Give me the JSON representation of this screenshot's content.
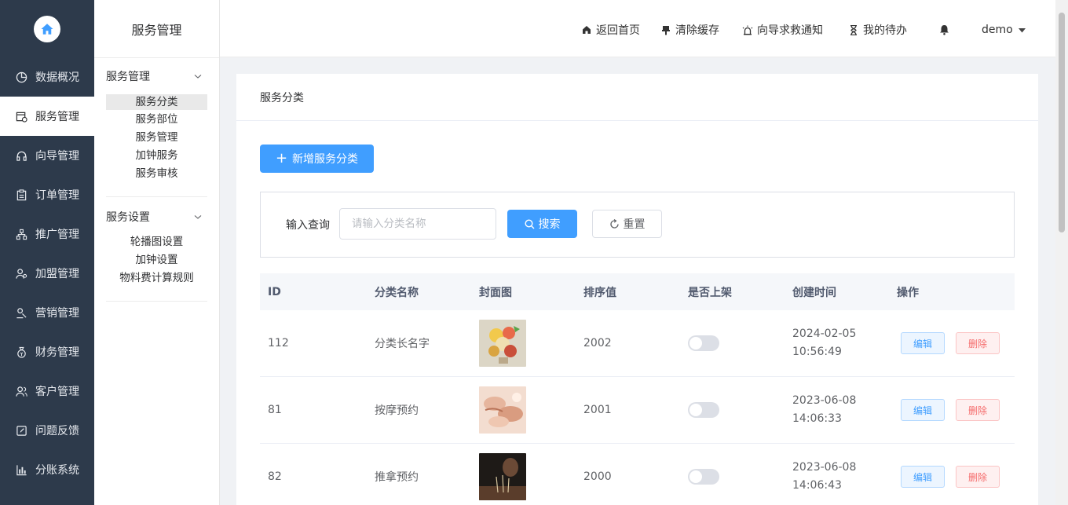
{
  "colors": {
    "sidebar_bg": "#2d3a4b",
    "primary": "#409eff",
    "danger": "#f56c6c"
  },
  "nav": {
    "logo_icon": "home-icon",
    "items": [
      {
        "label": "数据概况",
        "icon": "pie-chart-icon"
      },
      {
        "label": "服务管理",
        "icon": "service-calendar-icon",
        "active": true
      },
      {
        "label": "向导管理",
        "icon": "headset-icon"
      },
      {
        "label": "订单管理",
        "icon": "clipboard-icon"
      },
      {
        "label": "推广管理",
        "icon": "org-tree-icon"
      },
      {
        "label": "加盟管理",
        "icon": "user-group-icon"
      },
      {
        "label": "营销管理",
        "icon": "badge-icon"
      },
      {
        "label": "财务管理",
        "icon": "money-bag-icon"
      },
      {
        "label": "客户管理",
        "icon": "users-icon"
      },
      {
        "label": "问题反馈",
        "icon": "edit-square-icon"
      },
      {
        "label": "分账系统",
        "icon": "bar-chart-icon"
      }
    ]
  },
  "submenu": {
    "title": "服务管理",
    "groups": [
      {
        "label": "服务管理",
        "items": [
          "服务分类",
          "服务部位",
          "服务管理",
          "加钟服务",
          "服务审核"
        ],
        "active_index": 0
      },
      {
        "label": "服务设置",
        "items": [
          "轮播图设置",
          "加钟设置",
          "物料费计算规则"
        ]
      }
    ]
  },
  "header": {
    "home": "返回首页",
    "clear_cache": "清除缓存",
    "rescue": "向导求救通知",
    "todo": "我的待办",
    "user": "demo"
  },
  "page": {
    "breadcrumb": "服务分类",
    "add_button": "新增服务分类",
    "search_label": "输入查询",
    "search_placeholder": "请输入分类名称",
    "search_button": "搜索",
    "reset_button": "重置"
  },
  "table": {
    "headers": [
      "ID",
      "分类名称",
      "封面图",
      "排序值",
      "是否上架",
      "创建时间",
      "操作"
    ],
    "edit_label": "编辑",
    "delete_label": "删除",
    "rows": [
      {
        "id": "112",
        "name": "分类长名字",
        "cover": "fruit-photo",
        "sort": "2002",
        "listed": false,
        "date": "2024-02-05",
        "time": "10:56:49"
      },
      {
        "id": "81",
        "name": "按摩预约",
        "cover": "massage-photo",
        "sort": "2001",
        "listed": false,
        "date": "2023-06-08",
        "time": "14:06:33"
      },
      {
        "id": "82",
        "name": "推拿预约",
        "cover": "acupuncture-photo",
        "sort": "2000",
        "listed": false,
        "date": "2023-06-08",
        "time": "14:06:43"
      }
    ]
  }
}
